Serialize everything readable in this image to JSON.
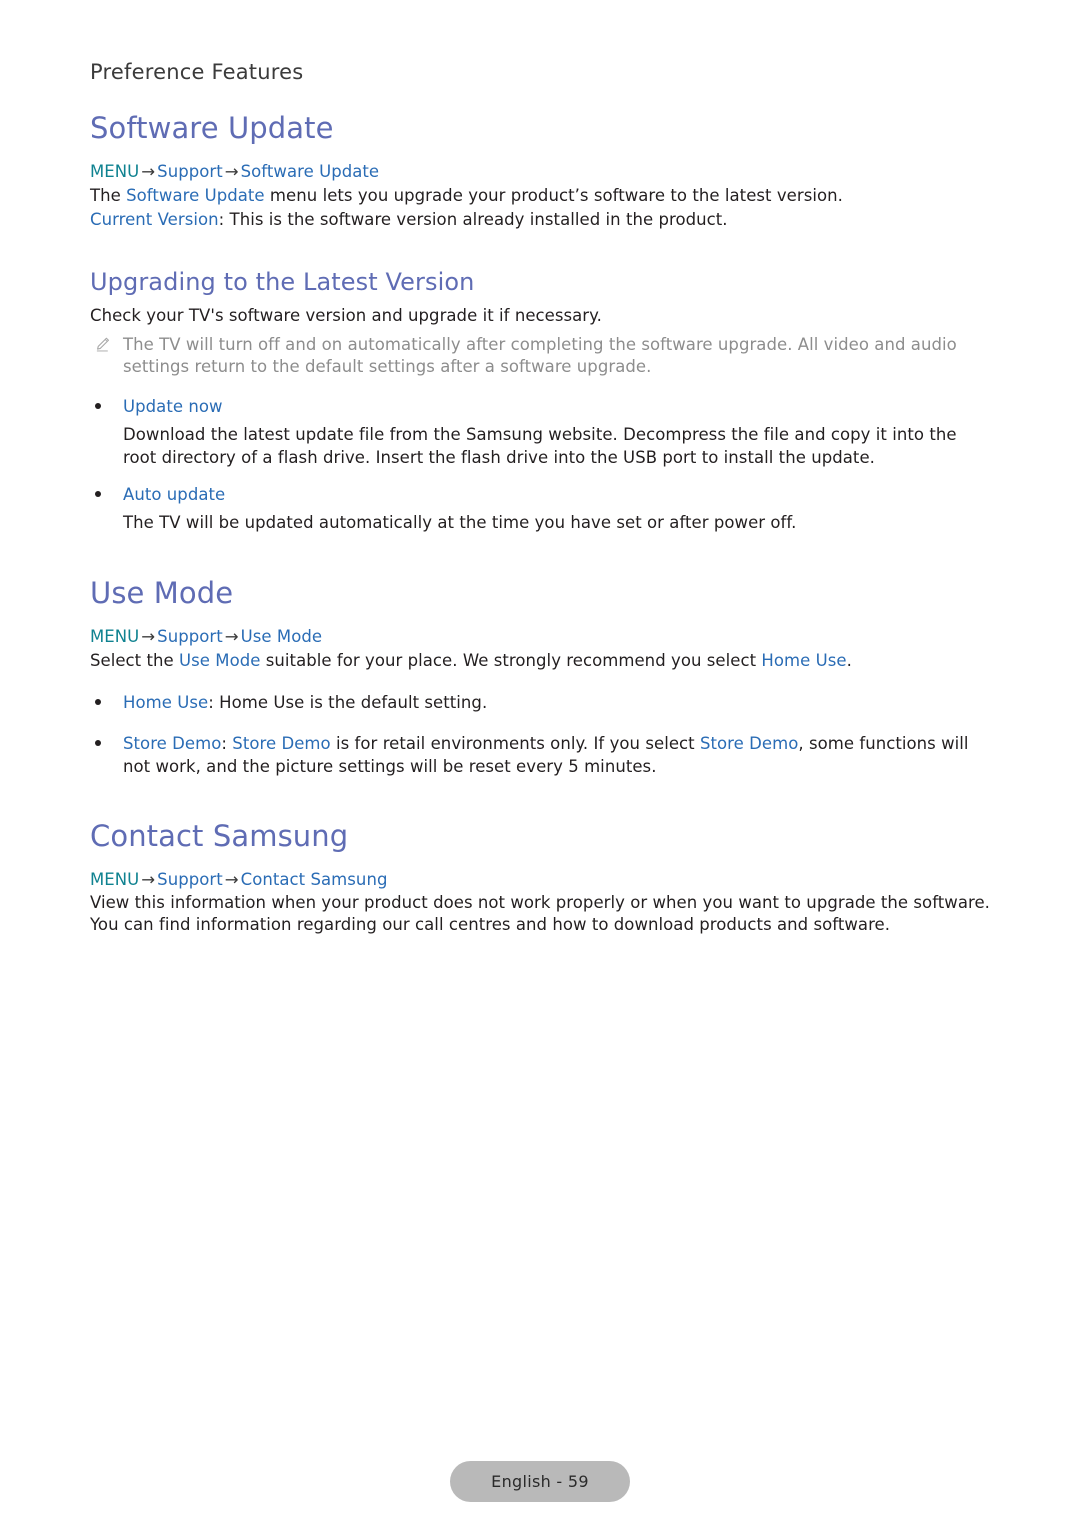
{
  "document": {
    "running_head": "Preference Features",
    "footer_label": "English - 59"
  },
  "colors": {
    "heading": "#5f6cb4",
    "keyword_teal": "#0f8290",
    "keyword_blue": "#2a6cb5",
    "body": "#231f20",
    "note": "#8d8d8d",
    "footer_pill": "#b9b9b9"
  },
  "sections": {
    "software_update": {
      "title": "Software Update",
      "path": {
        "menu": "MENU",
        "arrow1": "→",
        "support": "Support",
        "arrow2": "→",
        "leaf": "Software Update"
      },
      "line1_pre": "The ",
      "line1_kw": "Software Update",
      "line1_post": " menu lets you upgrade your product’s software to the latest version.",
      "line2_kw": "Current Version",
      "line2_post": ": This is the software version already installed in the product."
    },
    "upgrading": {
      "title": "Upgrading to the Latest Version",
      "intro": "Check your TV's software version and upgrade it if necessary.",
      "note": "The TV will turn off and on automatically after completing the software upgrade. All video and audio settings return to the default settings after a software upgrade.",
      "bullets": [
        {
          "label": "Update now",
          "body": "Download the latest update file from the Samsung website. Decompress the file and copy it into the root directory of a flash drive. Insert the flash drive into the USB port to install the update."
        },
        {
          "label": "Auto update",
          "body": "The TV will be updated automatically at the time you have set or after power off."
        }
      ]
    },
    "use_mode": {
      "title": "Use Mode",
      "path": {
        "menu": "MENU",
        "arrow1": "→",
        "support": "Support",
        "arrow2": "→",
        "leaf": "Use Mode"
      },
      "intro_pre": "Select the ",
      "intro_kw1": "Use Mode",
      "intro_mid": " suitable for your place. We strongly recommend you select ",
      "intro_kw2": "Home Use",
      "intro_post": ".",
      "bullets": [
        {
          "kw1": "Home Use",
          "after_kw1": ": Home Use is the default setting."
        },
        {
          "kw1": "Store Demo",
          "sep": ": ",
          "kw2": "Store Demo",
          "mid": " is for retail environments only. If you select ",
          "kw3": "Store Demo",
          "tail": ", some functions will not work, and the picture settings will be reset every 5 minutes."
        }
      ]
    },
    "contact_samsung": {
      "title": "Contact Samsung",
      "path": {
        "menu": "MENU",
        "arrow1": "→",
        "support": "Support",
        "arrow2": "→",
        "leaf": "Contact Samsung"
      },
      "body": "View this information when your product does not work properly or when you want to upgrade the software. You can find information regarding our call centres and how to download products and software."
    }
  },
  "icons": {
    "pencil": "pencil-icon",
    "bullet": "bullet-dot-icon"
  }
}
